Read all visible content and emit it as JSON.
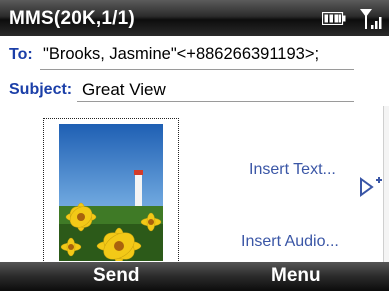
{
  "status_bar": {
    "title": "MMS(20K,1/1)",
    "battery_icon": "battery-icon",
    "signal_icon": "signal-strength-icon"
  },
  "compose": {
    "to_label": "To:",
    "to_value": "\"Brooks, Jasmine\"<+886266391193>;",
    "subject_label": "Subject:",
    "subject_value": "Great View"
  },
  "slide": {
    "image_icon": "photo-thumbnail",
    "insert_text_label": "Insert Text...",
    "insert_audio_label": "Insert Audio...",
    "next_slide_icon": "add-slide-arrow-icon"
  },
  "softkeys": {
    "left": "Send",
    "right": "Menu"
  },
  "colors": {
    "label_blue": "#1b3fa8",
    "link_blue": "#3a56a6",
    "bar_dark": "#1a1a1a"
  }
}
